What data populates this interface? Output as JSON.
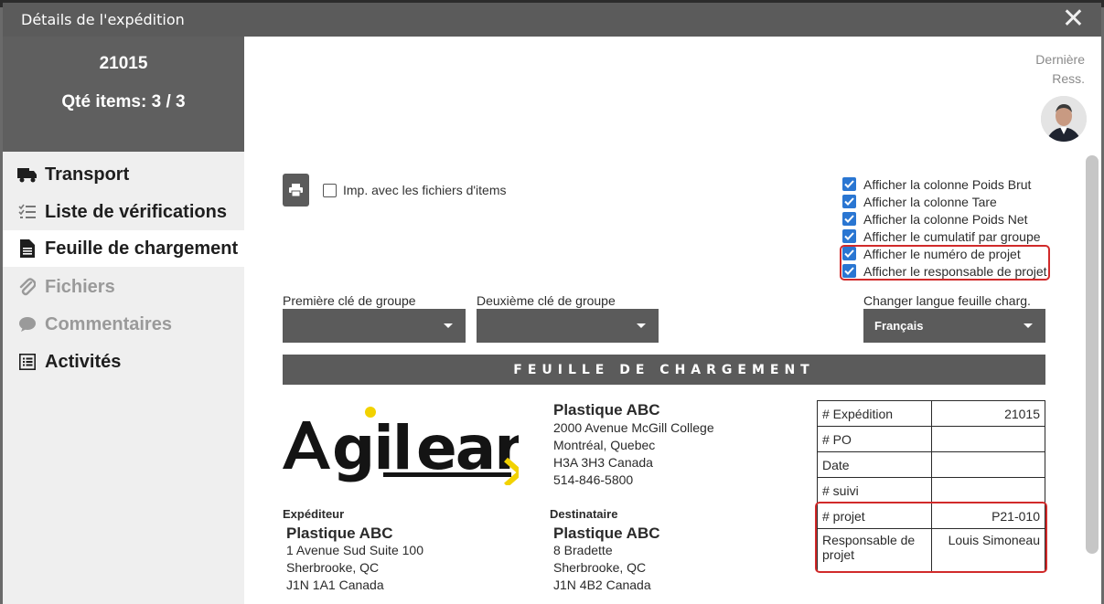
{
  "window": {
    "title": "Détails de l'expédition"
  },
  "header": {
    "number": "21015",
    "qty": "Qté items: 3 / 3",
    "derniere_line1": "Dernière",
    "derniere_line2": "Ress."
  },
  "sidebar": {
    "items": [
      {
        "label": "Transport",
        "icon": "truck-icon"
      },
      {
        "label": "Liste de vérifications",
        "icon": "checklist-icon"
      },
      {
        "label": "Feuille de chargement",
        "icon": "document-icon"
      },
      {
        "label": "Fichiers",
        "icon": "paperclip-icon"
      },
      {
        "label": "Commentaires",
        "icon": "comment-icon"
      },
      {
        "label": "Activités",
        "icon": "list-icon"
      }
    ],
    "active": "Feuille de chargement"
  },
  "toolbar": {
    "print_icon": "print-icon",
    "imp_label": "Imp. avec les fichiers d'items",
    "imp_checked": false
  },
  "options": [
    {
      "label": "Afficher la colonne Poids Brut",
      "checked": true
    },
    {
      "label": "Afficher la colonne Tare",
      "checked": true
    },
    {
      "label": "Afficher la colonne Poids Net",
      "checked": true
    },
    {
      "label": "Afficher le cumulatif par groupe",
      "checked": true
    },
    {
      "label": "Afficher le numéro de projet",
      "checked": true
    },
    {
      "label": "Afficher le responsable de projet",
      "checked": true
    }
  ],
  "groups": {
    "first_label": "Première clé de groupe",
    "first_value": "",
    "second_label": "Deuxième clé de groupe",
    "second_value": "",
    "lang_label": "Changer langue feuille charg.",
    "lang_value": "Français"
  },
  "banner": "FEUILLE DE CHARGEMENT",
  "logo_text": "Agilean",
  "company": {
    "name": "Plastique ABC",
    "lines": [
      "2000 Avenue McGill College",
      "Montréal, Quebec",
      "H3A 3H3 Canada",
      "514-846-5800"
    ]
  },
  "shipper": {
    "header": "Expéditeur",
    "name": "Plastique ABC",
    "lines": [
      "1 Avenue Sud Suite 100",
      "Sherbrooke, QC",
      "J1N 1A1 Canada"
    ]
  },
  "consignee": {
    "header": "Destinataire",
    "name": "Plastique ABC",
    "lines": [
      "8 Bradette",
      "Sherbrooke, QC",
      "J1N 4B2 Canada"
    ]
  },
  "info": [
    {
      "label": "# Expédition",
      "value": "21015"
    },
    {
      "label": "# PO",
      "value": ""
    },
    {
      "label": "Date",
      "value": ""
    },
    {
      "label": "# suivi",
      "value": ""
    },
    {
      "label": "# projet",
      "value": "P21-010"
    },
    {
      "label": "Responsable de projet",
      "value": "Louis Simoneau"
    }
  ],
  "colors": {
    "accent": "#2a76d2",
    "highlight": "#d12a2a",
    "dark": "#5b5b5b",
    "logo_yellow": "#f2d200"
  }
}
